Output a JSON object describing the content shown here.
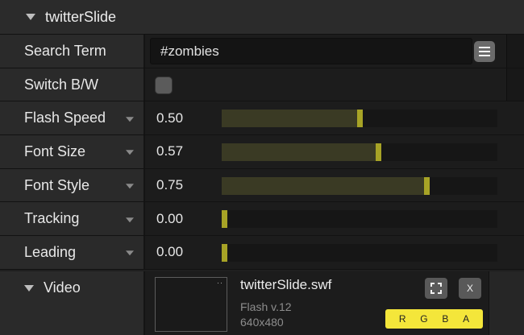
{
  "panel": {
    "title": "twitterSlide"
  },
  "params": {
    "search_term": {
      "label": "Search Term",
      "value": "#zombies"
    },
    "switch_bw": {
      "label": "Switch B/W"
    },
    "flash_speed": {
      "label": "Flash Speed",
      "value": "0.50",
      "level": 0.5
    },
    "font_size": {
      "label": "Font Size",
      "value": "0.57",
      "level": 0.57
    },
    "font_style": {
      "label": "Font Style",
      "value": "0.75",
      "level": 0.75
    },
    "tracking": {
      "label": "Tracking",
      "value": "0.00",
      "level": 0.0
    },
    "leading": {
      "label": "Leading",
      "value": "0.00",
      "level": 0.0
    }
  },
  "video": {
    "label": "Video",
    "file_name": "twitterSlide.swf",
    "flash_version": "Flash v.12",
    "dimensions": "640x480",
    "close_label": "X",
    "channels": [
      "R",
      "G",
      "B",
      "A"
    ]
  },
  "icons": {
    "collapse": "triangle-down-icon",
    "menu": "hamburger-menu-icon",
    "fullscreen": "fullscreen-icon",
    "thumb_dots": "ellipsis-icon"
  },
  "colors": {
    "slider_handle": "#a7a326",
    "slider_fill": "#3a3a24",
    "rgba_badge": "#f4e63a"
  }
}
